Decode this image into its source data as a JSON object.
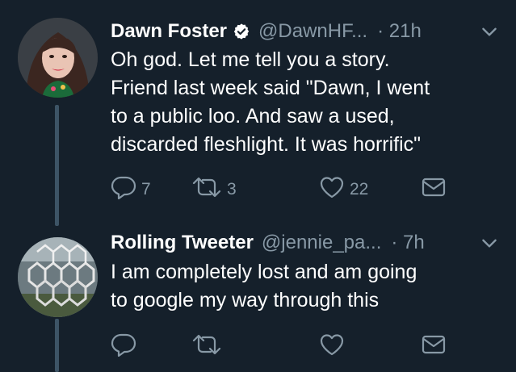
{
  "tweets": [
    {
      "name": "Dawn Foster",
      "verified": true,
      "handle": "@DawnHF...",
      "time": "· 21h",
      "text": "Oh god. Let me tell you a story.\nFriend last week said \"Dawn, I went\nto a public loo. And saw a used,\ndiscarded fleshlight. It was horrific\"",
      "replies": "7",
      "retweets": "3",
      "likes": "22"
    },
    {
      "name": "Rolling Tweeter",
      "verified": false,
      "handle": "@jennie_pa...",
      "time": "· 7h",
      "text": "I am completely lost and am going\nto google my way through this",
      "replies": "",
      "retweets": "",
      "likes": ""
    }
  ],
  "colors": {
    "background": "#15202b",
    "text": "#ffffff",
    "secondary": "#8899a6",
    "thread_line": "#3d5466"
  },
  "icons": [
    "reply-icon",
    "retweet-icon",
    "like-icon",
    "direct-message-icon",
    "chevron-down-icon",
    "verified-badge-icon"
  ]
}
